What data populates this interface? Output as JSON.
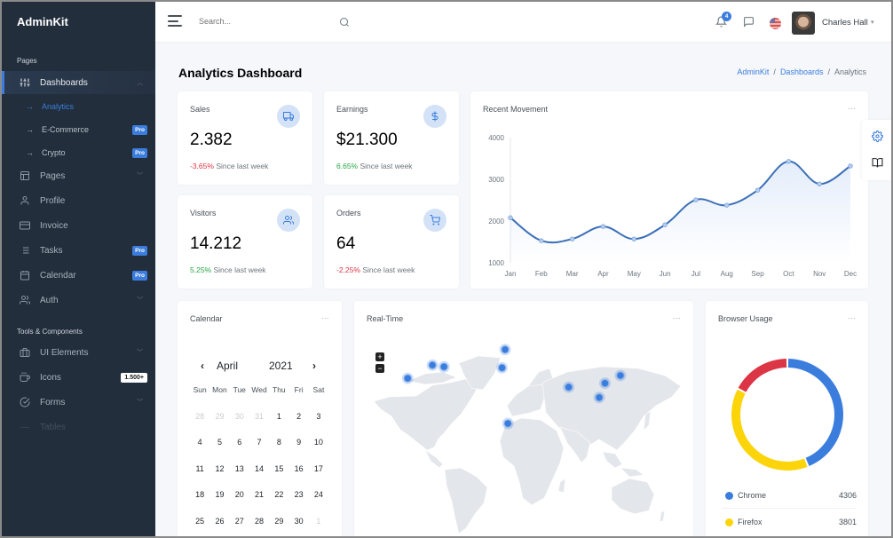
{
  "sidebar": {
    "brand": "AdminKit",
    "section_pages": "Pages",
    "section_tools": "Tools & Components",
    "items": [
      {
        "label": "Dashboards",
        "icon": "sliders-icon",
        "expanded": true,
        "active": true
      },
      {
        "label": "Pages",
        "icon": "layout-icon"
      },
      {
        "label": "Profile",
        "icon": "user-icon"
      },
      {
        "label": "Invoice",
        "icon": "credit-card-icon"
      },
      {
        "label": "Tasks",
        "icon": "list-icon",
        "badge": "Pro"
      },
      {
        "label": "Calendar",
        "icon": "calendar-icon",
        "badge": "Pro"
      },
      {
        "label": "Auth",
        "icon": "users-icon"
      },
      {
        "label": "UI Elements",
        "icon": "briefcase-icon"
      },
      {
        "label": "Icons",
        "icon": "coffee-icon",
        "badge": "1.500+"
      },
      {
        "label": "Forms",
        "icon": "check-circle-icon"
      },
      {
        "label": "Tables",
        "icon": "minus-icon"
      }
    ],
    "sub_items": [
      {
        "label": "Analytics",
        "active": true
      },
      {
        "label": "E-Commerce",
        "badge": "Pro"
      },
      {
        "label": "Crypto",
        "badge": "Pro"
      }
    ]
  },
  "navbar": {
    "search_placeholder": "Search...",
    "notification_count": "4",
    "user_name": "Charles Hall",
    "colors": {
      "accent": "#3b7ddd"
    }
  },
  "page": {
    "title_bold": "Analytics",
    "title_rest": "Dashboard",
    "breadcrumb": [
      "AdminKit",
      "Dashboards",
      "Analytics"
    ]
  },
  "stats": [
    {
      "title": "Sales",
      "value": "2.382",
      "change": "-3.65%",
      "trend": "negative",
      "since": "Since last week",
      "icon": "truck-icon"
    },
    {
      "title": "Earnings",
      "value": "$21.300",
      "change": "6.65%",
      "trend": "positive",
      "since": "Since last week",
      "icon": "dollar-icon"
    },
    {
      "title": "Visitors",
      "value": "14.212",
      "change": "5.25%",
      "trend": "positive",
      "since": "Since last week",
      "icon": "users-icon"
    },
    {
      "title": "Orders",
      "value": "64",
      "change": "-2.25%",
      "trend": "negative",
      "since": "Since last week",
      "icon": "shopping-cart-icon"
    }
  ],
  "more_label": "...",
  "calendar": {
    "title": "Calendar",
    "month": "April",
    "year": "2021",
    "weekdays": [
      "Sun",
      "Mon",
      "Tue",
      "Wed",
      "Thu",
      "Fri",
      "Sat"
    ],
    "weeks": [
      [
        {
          "d": "28",
          "m": true
        },
        {
          "d": "29",
          "m": true
        },
        {
          "d": "30",
          "m": true
        },
        {
          "d": "31",
          "m": true
        },
        {
          "d": "1"
        },
        {
          "d": "2"
        },
        {
          "d": "3"
        }
      ],
      [
        {
          "d": "4"
        },
        {
          "d": "5"
        },
        {
          "d": "6"
        },
        {
          "d": "7"
        },
        {
          "d": "8"
        },
        {
          "d": "9"
        },
        {
          "d": "10"
        }
      ],
      [
        {
          "d": "11"
        },
        {
          "d": "12"
        },
        {
          "d": "13"
        },
        {
          "d": "14"
        },
        {
          "d": "15"
        },
        {
          "d": "16"
        },
        {
          "d": "17"
        }
      ],
      [
        {
          "d": "18"
        },
        {
          "d": "19"
        },
        {
          "d": "20"
        },
        {
          "d": "21"
        },
        {
          "d": "22"
        },
        {
          "d": "23"
        },
        {
          "d": "24"
        }
      ],
      [
        {
          "d": "25"
        },
        {
          "d": "26"
        },
        {
          "d": "27"
        },
        {
          "d": "28"
        },
        {
          "d": "29"
        },
        {
          "d": "30"
        },
        {
          "d": "1",
          "m": true
        }
      ]
    ]
  },
  "realtime": {
    "title": "Real-Time",
    "zoom_in": "+",
    "zoom_out": "−",
    "markers": [
      {
        "name": "Los Angeles",
        "lon": -118,
        "lat": 34
      },
      {
        "name": "Chicago",
        "lon": -88,
        "lat": 42
      },
      {
        "name": "New York",
        "lon": -74,
        "lat": 41
      },
      {
        "name": "London",
        "lon": 0,
        "lat": 51.5
      },
      {
        "name": "Madrid",
        "lon": -3.7,
        "lat": 40.4
      },
      {
        "name": "Lagos",
        "lon": 3.4,
        "lat": 6.5
      },
      {
        "name": "Delhi",
        "lon": 77,
        "lat": 28.6
      },
      {
        "name": "Hong Kong",
        "lon": 114,
        "lat": 22.3
      },
      {
        "name": "Shanghai",
        "lon": 121,
        "lat": 31
      },
      {
        "name": "Tokyo",
        "lon": 139.7,
        "lat": 35.7
      }
    ]
  },
  "chart_data": [
    {
      "type": "area",
      "title": "Recent Movement",
      "categories": [
        "Jan",
        "Feb",
        "Mar",
        "Apr",
        "May",
        "Jun",
        "Jul",
        "Aug",
        "Sep",
        "Oct",
        "Nov",
        "Dec"
      ],
      "values": [
        2080,
        1530,
        1570,
        1870,
        1570,
        1910,
        2510,
        2380,
        2740,
        3430,
        2890,
        3320
      ],
      "xlabel": "",
      "ylabel": "",
      "ylim": [
        1000,
        4000
      ],
      "yticks": [
        "4000",
        "3000",
        "2000",
        "1000"
      ],
      "grid": false,
      "color": "#3b7ddd"
    },
    {
      "type": "pie",
      "title": "Browser Usage",
      "donut": true,
      "slices": [
        {
          "label": "Chrome",
          "value": 4306,
          "color": "#3b7ddd",
          "shown_in_legend": true
        },
        {
          "label": "Firefox",
          "value": 3801,
          "color": "#fcd40a",
          "shown_in_legend": true
        },
        {
          "label": "",
          "value": 1700,
          "color": "#dc3545",
          "shown_in_legend": false
        }
      ]
    }
  ]
}
